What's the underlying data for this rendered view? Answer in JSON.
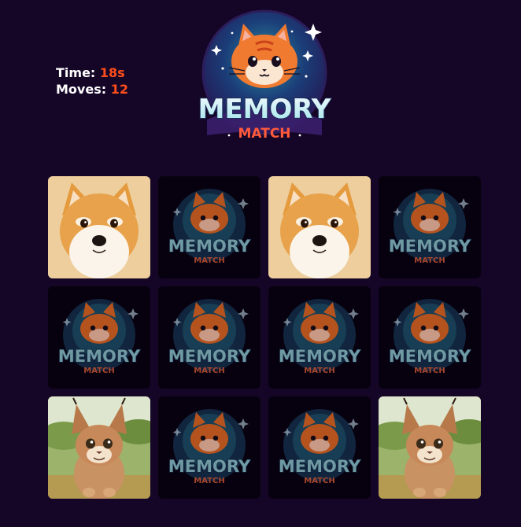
{
  "stats": {
    "time_label": "Time:",
    "time_value": "18s",
    "moves_label": "Moves:",
    "moves_value": "12"
  },
  "logo": {
    "line1": "MEMORY",
    "line2": "MATCH"
  },
  "card_back": {
    "line1": "MEMORY",
    "line2": "MATCH"
  },
  "cards": [
    {
      "state": "revealed",
      "image": "shiba-dog"
    },
    {
      "state": "hidden",
      "image": "card-back"
    },
    {
      "state": "revealed",
      "image": "shiba-dog"
    },
    {
      "state": "hidden",
      "image": "card-back"
    },
    {
      "state": "hidden",
      "image": "card-back"
    },
    {
      "state": "hidden",
      "image": "card-back"
    },
    {
      "state": "hidden",
      "image": "card-back"
    },
    {
      "state": "hidden",
      "image": "card-back"
    },
    {
      "state": "revealed",
      "image": "caracal-kitten"
    },
    {
      "state": "hidden",
      "image": "card-back"
    },
    {
      "state": "hidden",
      "image": "card-back"
    },
    {
      "state": "revealed",
      "image": "caracal-kitten"
    }
  ],
  "colors": {
    "background": "#150628",
    "stat_value": "#ff4d1c",
    "stat_label": "#ffffff",
    "card_back_bg": "#07010f"
  }
}
